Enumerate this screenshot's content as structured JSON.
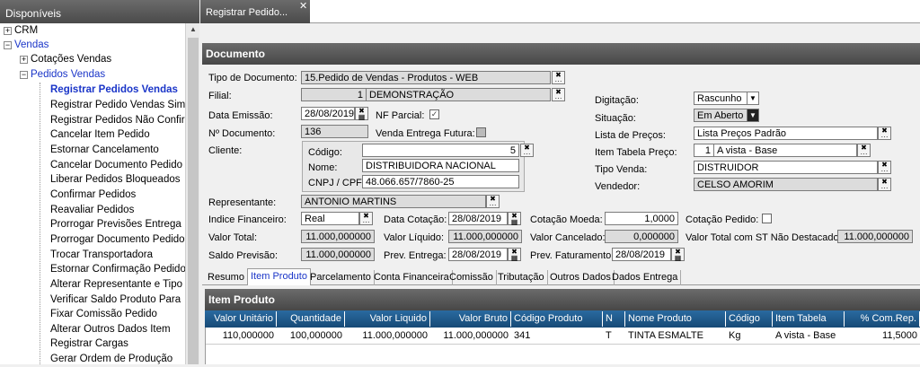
{
  "sidebar": {
    "title": "Disponíveis",
    "nodes": [
      {
        "label": "CRM",
        "expander": "+"
      },
      {
        "label": "Vendas",
        "expander": "−"
      },
      {
        "label": "Cotações Vendas",
        "expander": "+"
      },
      {
        "label": "Pedidos Vendas",
        "expander": "−"
      }
    ],
    "items": [
      "Registrar Pedidos Vendas",
      "Registrar Pedido Vendas Sim",
      "Registrar Pedidos Não Confir",
      "Cancelar Item Pedido",
      "Estornar Cancelamento",
      "Cancelar Documento Pedido",
      "Liberar Pedidos Bloqueados",
      "Confirmar Pedidos",
      "Reavaliar Pedidos",
      "Prorrogar Previsões Entrega",
      "Prorrogar Documento Pedido",
      "Trocar Transportadora",
      "Estornar Confirmação Pedido",
      "Alterar Representante e Tipo",
      "Verificar Saldo Produto Para",
      "Fixar Comissão Pedido",
      "Alterar Outros Dados Item",
      "Registrar Cargas",
      "Gerar Ordem de Produção"
    ]
  },
  "tab": {
    "title": "Registrar Pedido...",
    "close": "✕"
  },
  "documento": {
    "header": "Documento",
    "tipo_documento_label": "Tipo de Documento:",
    "tipo_documento": "15.Pedido de Vendas - Produtos - WEB",
    "filial_label": "Filial:",
    "filial_code": "1",
    "filial_name": "DEMONSTRAÇÃO",
    "data_emissao_label": "Data Emissão:",
    "data_emissao": "28/08/2019",
    "nf_parcial_label": "NF Parcial:",
    "nf_parcial_check": "✓",
    "n_documento_label": "Nº Documento:",
    "n_documento": "136",
    "venda_entrega_futura_label": "Venda Entrega Futura:",
    "cliente_label": "Cliente:",
    "codigo_label": "Código:",
    "codigo": "5",
    "nome_label": "Nome:",
    "nome": "DISTRIBUIDORA NACIONAL",
    "cnpj_label": "CNPJ / CPF:",
    "cnpj": "48.066.657/7860-25",
    "representante_label": "Representante:",
    "representante": "ANTONIO MARTINS",
    "indice_label": "Indice Financeiro:",
    "indice": "Real",
    "data_cotacao_label": "Data Cotação:",
    "data_cotacao": "28/08/2019",
    "cotacao_moeda_label": "Cotação Moeda:",
    "cotacao_moeda": "1,0000",
    "cotacao_pedido_label": "Cotação Pedido:",
    "valor_total_label": "Valor Total:",
    "valor_total": "11.000,000000",
    "valor_liquido_label": "Valor Líquido:",
    "valor_liquido": "11.000,000000",
    "valor_cancelado_label": "Valor Cancelado:",
    "valor_cancelado": "0,000000",
    "valor_total_st_label": "Valor Total com ST Não Destacado:",
    "valor_total_st": "11.000,000000",
    "saldo_previsao_label": "Saldo Previsão:",
    "saldo_previsao": "11.000,000000",
    "prev_entrega_label": "Prev. Entrega:",
    "prev_entrega": "28/08/2019",
    "prev_faturamento_label": "Prev. Faturamento:",
    "prev_faturamento": "28/08/2019",
    "digitacao_label": "Digitação:",
    "digitacao": "Rascunho",
    "situacao_label": "Situação:",
    "situacao": "Em Aberto",
    "lista_precos_label": "Lista de Preços:",
    "lista_precos": "Lista Preços Padrão",
    "item_tabela_label": "Item Tabela Preço:",
    "item_tabela_code": "1",
    "item_tabela": "A vista - Base",
    "tipo_venda_label": "Tipo Venda:",
    "tipo_venda": "DISTRUIDOR",
    "vendedor_label": "Vendedor:",
    "vendedor": "CELSO AMORIM"
  },
  "detail_tabs": [
    "Resumo",
    "Item Produto",
    "Parcelamento",
    "Conta Financeira",
    "Comissão",
    "Tributação",
    "Outros Dados",
    "Dados Entrega"
  ],
  "item_produto": {
    "header": "Item Produto",
    "columns": [
      "Valor Unitário",
      "Quantidade",
      "Valor Liquido",
      "Valor Bruto",
      "Código Produto",
      "N",
      "Nome Produto",
      "Código",
      "Item Tabela",
      "% Com.Rep."
    ],
    "rows": [
      [
        "110,000000",
        "100,000000",
        "11.000,000000",
        "11.000,000000",
        "341",
        "T",
        "TINTA ESMALTE",
        "Kg",
        "A vista - Base",
        "11,5000"
      ]
    ]
  },
  "colors": {
    "header_bg": "#555555",
    "accent_blue": "#1a35c8",
    "grid_header": "#1e5a8c"
  }
}
